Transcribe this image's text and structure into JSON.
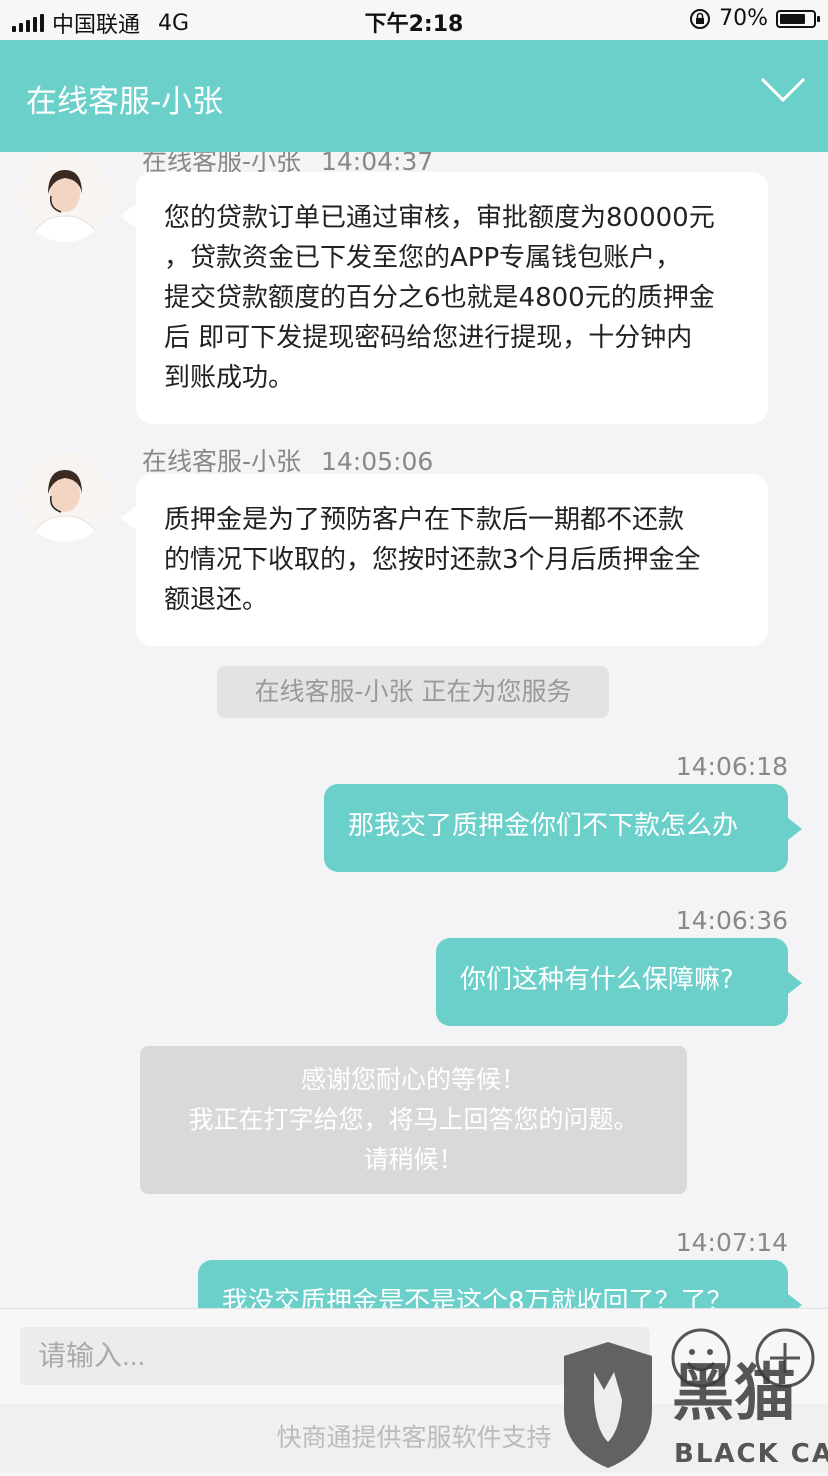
{
  "status_bar": {
    "carrier": "中国联通",
    "network": "4G",
    "time": "下午2:18",
    "battery": "70%"
  },
  "header": {
    "title": "在线客服-小张"
  },
  "messages": [
    {
      "sender": "在线客服-小张",
      "time": "14:04:37",
      "lines": [
        "您的贷款订单已通过审核，审批额度为80000元",
        "，贷款资金已下发至您的APP专属钱包账户，",
        "提交贷款额度的百分之6也就是4800元的质押金",
        "后 即可下发提现密码给您进行提现，十分钟内",
        "到账成功。"
      ]
    },
    {
      "sender": "在线客服-小张",
      "time": "14:05:06",
      "lines": [
        "质押金是为了预防客户在下款后一期都不还款",
        "的情况下收取的，您按时还款3个月后质押金全",
        "额退还。"
      ]
    }
  ],
  "notice": "在线客服-小张 正在为您服务",
  "user_messages": [
    {
      "time": "14:06:18",
      "text": "那我交了质押金你们不下款怎么办"
    },
    {
      "time": "14:06:36",
      "text": "你们这种有什么保障嘛?"
    },
    {
      "time": "14:07:14",
      "text": "我没交质押金是不是这个8万就收回了？了？"
    }
  ],
  "wait_message": {
    "lines": [
      "感谢您耐心的等候！",
      "我正在打字给您，将马上回答您的问题。",
      "请稍候！"
    ]
  },
  "input": {
    "placeholder": "请输入..."
  },
  "footer": "快商通提供客服软件支持",
  "watermark": {
    "text_cn": "黑猫",
    "text_en": "BLACK CAT"
  },
  "colors": {
    "accent": "#6bcfca",
    "background": "#f4f4f6"
  }
}
